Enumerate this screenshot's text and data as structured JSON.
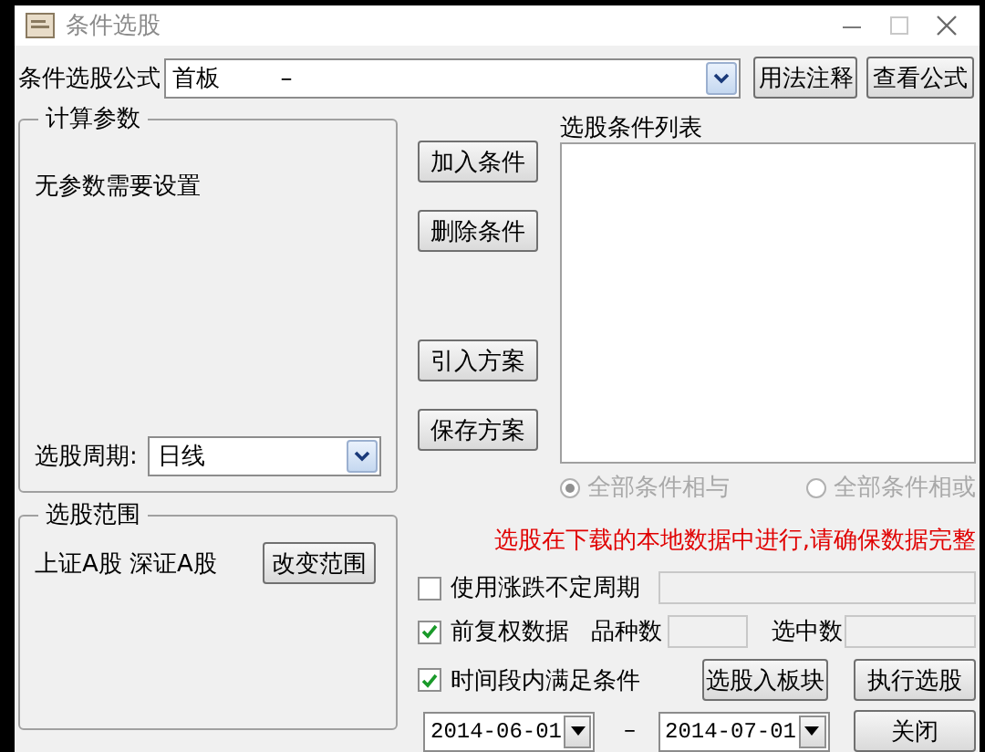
{
  "window": {
    "title": "条件选股"
  },
  "formula": {
    "label": "条件选股公式",
    "value": "首板        –"
  },
  "formula_buttons": [
    "用法注释",
    "查看公式"
  ],
  "params_group": {
    "title": "计算参数",
    "message": "无参数需要设置",
    "period_label": "选股周期:",
    "period_value": "日线"
  },
  "condition_buttons": [
    "加入条件",
    "删除条件",
    "引入方案",
    "保存方案"
  ],
  "condition_list": {
    "label": "选股条件列表"
  },
  "logic_options": [
    {
      "label": "全部条件相与",
      "selected": true,
      "disabled": true
    },
    {
      "label": "全部条件相或",
      "selected": false,
      "disabled": true
    }
  ],
  "scope_group": {
    "title": "选股范围",
    "markets": "上证A股 深证A股",
    "button": "改变范围"
  },
  "notice": "选股在下载的本地数据中进行,请确保数据完整",
  "variable_period": {
    "label": "使用涨跌不定周期",
    "checked": false
  },
  "adjusted_data": {
    "label": "前复权数据",
    "checked": true
  },
  "counts": [
    {
      "label": "品种数"
    },
    {
      "label": "选中数"
    }
  ],
  "time_range": {
    "label": "时间段内满足条件",
    "checked": true,
    "start": "2014-06-01",
    "separator": "–",
    "end": "2014-07-01"
  },
  "action_buttons": [
    "选股入板块",
    "执行选股",
    "关闭"
  ]
}
